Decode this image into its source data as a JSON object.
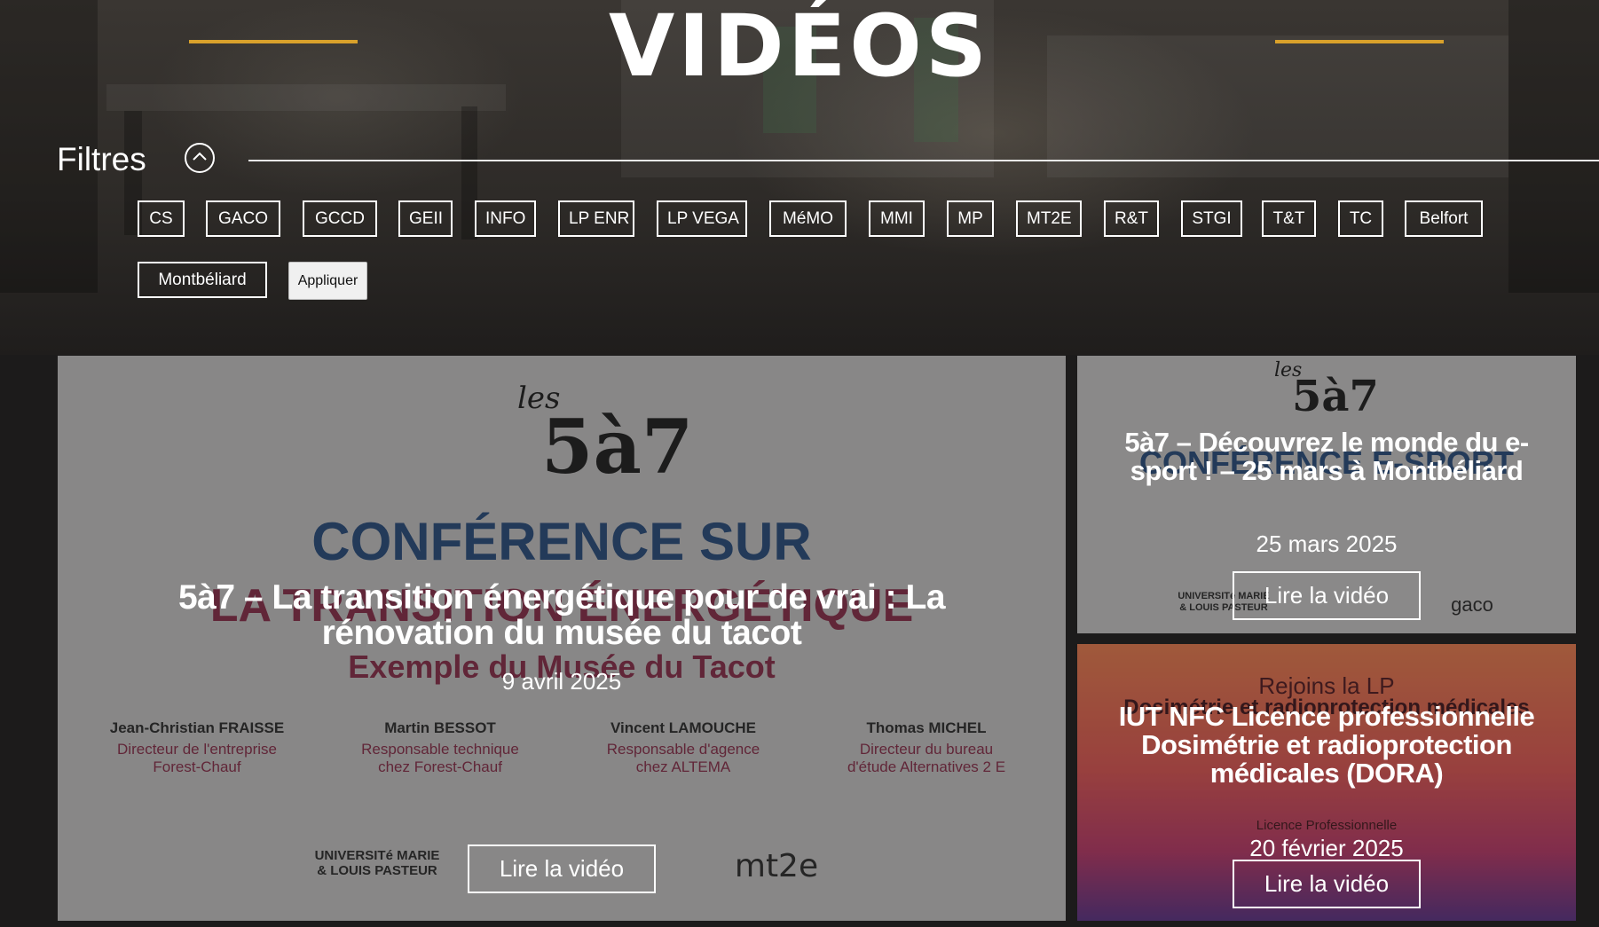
{
  "page": {
    "title": "VIDÉOS"
  },
  "filters": {
    "label": "Filtres",
    "toggle_icon": "chevron-up-icon",
    "chips": [
      "CS",
      "GACO",
      "GCCD",
      "GEII",
      "INFO",
      "LP ENR",
      "LP VEGA",
      "MéMO",
      "MMI",
      "MP",
      "MT2E",
      "R&T",
      "STGI",
      "T&T",
      "TC",
      "Belfort",
      "Montbéliard"
    ],
    "apply_label": "Appliquer"
  },
  "videos": [
    {
      "title": "5à7 – La transition énergétique pour de vrai : La rénovation du musée du tacot",
      "date": "9 avril 2025",
      "button": "Lire la vidéo",
      "poster": {
        "series_small": "les",
        "series_big": "5à7",
        "heading_1": "CONFÉRENCE SUR",
        "heading_2": "LA TRANSITION ÉNERGÉTIQUE",
        "heading_3": "Exemple du Musée du Tacot",
        "speakers": [
          {
            "name": "Jean-Christian FRAISSE",
            "role": "Directeur de l'entreprise Forest-Chauf"
          },
          {
            "name": "Martin BESSOT",
            "role": "Responsable technique chez Forest-Chauf"
          },
          {
            "name": "Vincent LAMOUCHE",
            "role": "Responsable d'agence chez ALTEMA"
          },
          {
            "name": "Thomas MICHEL",
            "role": "Directeur du bureau d'étude Alternatives 2 E"
          }
        ],
        "logo_1": "UNIVERSITé MARIE & LOUIS PASTEUR",
        "logo_2": "mt2e"
      }
    },
    {
      "title": "5à7 – Découvrez le monde du e-sport ! – 25 mars à Montbéliard",
      "date": "25 mars 2025",
      "button": "Lire la vidéo",
      "poster": {
        "series_small": "les",
        "series_big": "5à7",
        "heading_1": "CONFÉRENCE E-SPORT",
        "logo_1": "UNIVERSITé MARIE & LOUIS PASTEUR",
        "logo_2": "gaco"
      }
    },
    {
      "title": "IUT NFC Licence professionnelle Dosimétrie et radioprotection médicales (DORA)",
      "date": "20 février 2025",
      "button": "Lire la vidéo",
      "poster": {
        "line_1": "Rejoins la LP",
        "line_2": "Dosimétrie et radioprotection médicales",
        "line_3": "Licence Professionnelle"
      }
    }
  ]
}
